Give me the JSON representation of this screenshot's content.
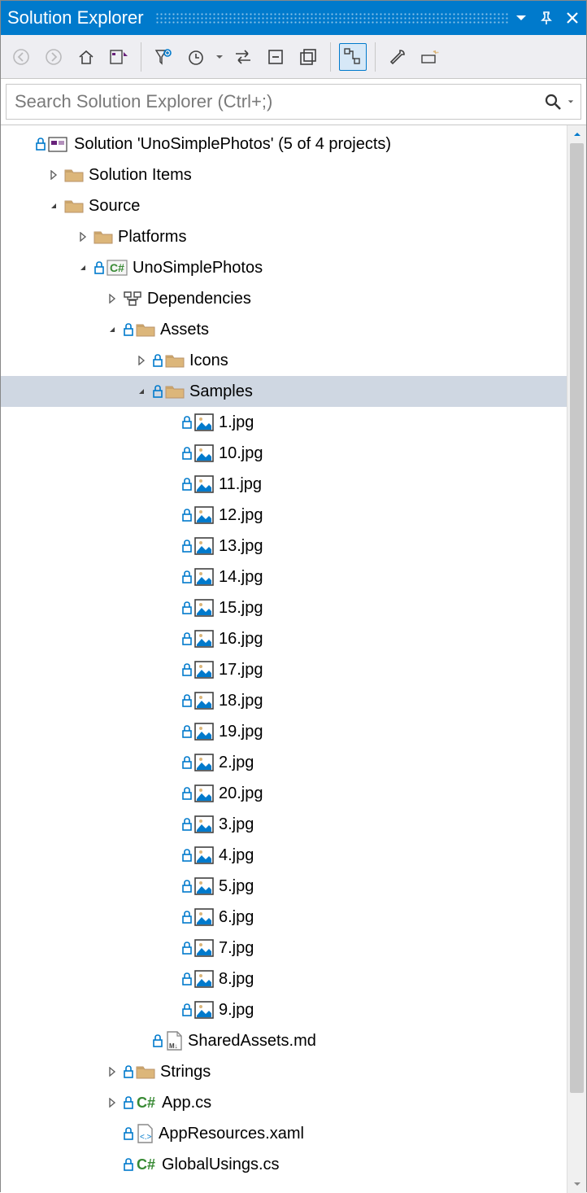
{
  "title": "Solution Explorer",
  "search_placeholder": "Search Solution Explorer (Ctrl+;)",
  "tree": [
    {
      "indent": 0,
      "expander": "none",
      "lock": true,
      "icon": "solution",
      "label": "Solution 'UnoSimplePhotos' (5 of 4 projects)",
      "selected": false
    },
    {
      "indent": 1,
      "expander": "closed",
      "lock": false,
      "icon": "folder",
      "label": "Solution Items",
      "selected": false
    },
    {
      "indent": 1,
      "expander": "open",
      "lock": false,
      "icon": "folder",
      "label": "Source",
      "selected": false
    },
    {
      "indent": 2,
      "expander": "closed",
      "lock": false,
      "icon": "folder",
      "label": "Platforms",
      "selected": false
    },
    {
      "indent": 2,
      "expander": "open",
      "lock": true,
      "icon": "csproj",
      "label": "UnoSimplePhotos",
      "selected": false
    },
    {
      "indent": 3,
      "expander": "closed",
      "lock": false,
      "icon": "deps",
      "label": "Dependencies",
      "selected": false
    },
    {
      "indent": 3,
      "expander": "open",
      "lock": true,
      "icon": "folder",
      "label": "Assets",
      "selected": false
    },
    {
      "indent": 4,
      "expander": "closed",
      "lock": true,
      "icon": "folder",
      "label": "Icons",
      "selected": false
    },
    {
      "indent": 4,
      "expander": "open",
      "lock": true,
      "icon": "folder",
      "label": "Samples",
      "selected": true
    },
    {
      "indent": 5,
      "expander": "none",
      "lock": true,
      "icon": "image",
      "label": "1.jpg",
      "selected": false
    },
    {
      "indent": 5,
      "expander": "none",
      "lock": true,
      "icon": "image",
      "label": "10.jpg",
      "selected": false
    },
    {
      "indent": 5,
      "expander": "none",
      "lock": true,
      "icon": "image",
      "label": "11.jpg",
      "selected": false
    },
    {
      "indent": 5,
      "expander": "none",
      "lock": true,
      "icon": "image",
      "label": "12.jpg",
      "selected": false
    },
    {
      "indent": 5,
      "expander": "none",
      "lock": true,
      "icon": "image",
      "label": "13.jpg",
      "selected": false
    },
    {
      "indent": 5,
      "expander": "none",
      "lock": true,
      "icon": "image",
      "label": "14.jpg",
      "selected": false
    },
    {
      "indent": 5,
      "expander": "none",
      "lock": true,
      "icon": "image",
      "label": "15.jpg",
      "selected": false
    },
    {
      "indent": 5,
      "expander": "none",
      "lock": true,
      "icon": "image",
      "label": "16.jpg",
      "selected": false
    },
    {
      "indent": 5,
      "expander": "none",
      "lock": true,
      "icon": "image",
      "label": "17.jpg",
      "selected": false
    },
    {
      "indent": 5,
      "expander": "none",
      "lock": true,
      "icon": "image",
      "label": "18.jpg",
      "selected": false
    },
    {
      "indent": 5,
      "expander": "none",
      "lock": true,
      "icon": "image",
      "label": "19.jpg",
      "selected": false
    },
    {
      "indent": 5,
      "expander": "none",
      "lock": true,
      "icon": "image",
      "label": "2.jpg",
      "selected": false
    },
    {
      "indent": 5,
      "expander": "none",
      "lock": true,
      "icon": "image",
      "label": "20.jpg",
      "selected": false
    },
    {
      "indent": 5,
      "expander": "none",
      "lock": true,
      "icon": "image",
      "label": "3.jpg",
      "selected": false
    },
    {
      "indent": 5,
      "expander": "none",
      "lock": true,
      "icon": "image",
      "label": "4.jpg",
      "selected": false
    },
    {
      "indent": 5,
      "expander": "none",
      "lock": true,
      "icon": "image",
      "label": "5.jpg",
      "selected": false
    },
    {
      "indent": 5,
      "expander": "none",
      "lock": true,
      "icon": "image",
      "label": "6.jpg",
      "selected": false
    },
    {
      "indent": 5,
      "expander": "none",
      "lock": true,
      "icon": "image",
      "label": "7.jpg",
      "selected": false
    },
    {
      "indent": 5,
      "expander": "none",
      "lock": true,
      "icon": "image",
      "label": "8.jpg",
      "selected": false
    },
    {
      "indent": 5,
      "expander": "none",
      "lock": true,
      "icon": "image",
      "label": "9.jpg",
      "selected": false
    },
    {
      "indent": 4,
      "expander": "none",
      "lock": true,
      "icon": "md",
      "label": "SharedAssets.md",
      "selected": false
    },
    {
      "indent": 3,
      "expander": "closed",
      "lock": true,
      "icon": "folder",
      "label": "Strings",
      "selected": false
    },
    {
      "indent": 3,
      "expander": "closed",
      "lock": true,
      "icon": "cs",
      "label": "App.cs",
      "selected": false
    },
    {
      "indent": 3,
      "expander": "none",
      "lock": true,
      "icon": "xaml",
      "label": "AppResources.xaml",
      "selected": false
    },
    {
      "indent": 3,
      "expander": "none",
      "lock": true,
      "icon": "cs",
      "label": "GlobalUsings.cs",
      "selected": false
    }
  ]
}
